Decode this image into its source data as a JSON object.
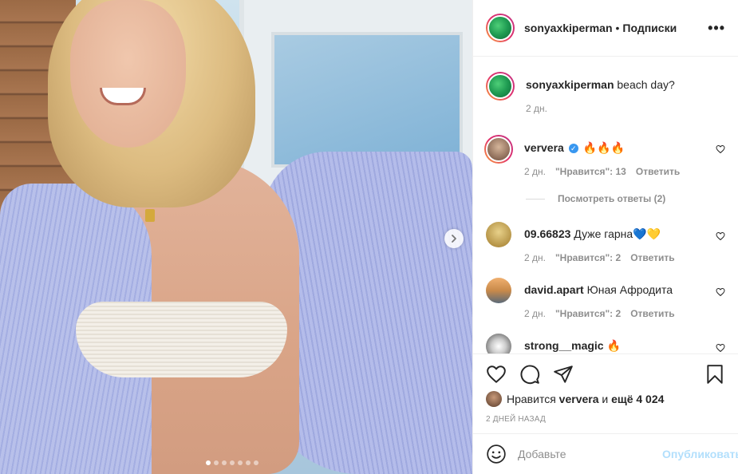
{
  "post": {
    "author": "sonyaxkiperman",
    "separator": "•",
    "follow_label": "Подписки",
    "more_label": "•••",
    "photo_count": 7,
    "photo_active_index": 0
  },
  "caption": {
    "user": "sonyaxkiperman",
    "text": "beach day?",
    "time": "2 дн."
  },
  "comments": [
    {
      "user": "ververa",
      "verified": true,
      "text": "🔥🔥🔥",
      "time": "2 дн.",
      "likes": "\"Нравится\": 13",
      "reply": "Ответить",
      "view_replies": "Посмотреть ответы (2)",
      "avatar_color": "#6b4a3a"
    },
    {
      "user": "09.66823",
      "verified": false,
      "text": "Дуже гарна💙💛",
      "time": "2 дн.",
      "likes": "\"Нравится\": 2",
      "reply": "Ответить",
      "avatar_color": "#c9a54a"
    },
    {
      "user": "david.apart",
      "verified": false,
      "text": "Юная Афродита",
      "time": "2 дн.",
      "likes": "\"Нравится\": 2",
      "reply": "Ответить",
      "avatar_color": "#c98a4a"
    },
    {
      "user": "strong__magic",
      "verified": false,
      "text": "🔥",
      "avatar_color": "#8a8a8a"
    }
  ],
  "likes_line": {
    "prefix": "Нравится",
    "user": "ververa",
    "middle": "и",
    "count": "ещё 4 024"
  },
  "timestamp": "2 ДНЕЙ НАЗАД",
  "comment_box": {
    "placeholder": "Добавьте комментарий...",
    "placeholder_visible": "Добавьте",
    "publish_label": "Опубликовать"
  },
  "icons": {
    "like": "heart-icon",
    "comment": "comment-icon",
    "share": "share-icon",
    "save": "bookmark-icon",
    "emoji": "emoji-icon",
    "next": "chevron-right-icon"
  },
  "colors": {
    "text": "#262626",
    "muted": "#8e8e8e",
    "link_disabled": "#b2dffc",
    "verified": "#3897f0"
  }
}
